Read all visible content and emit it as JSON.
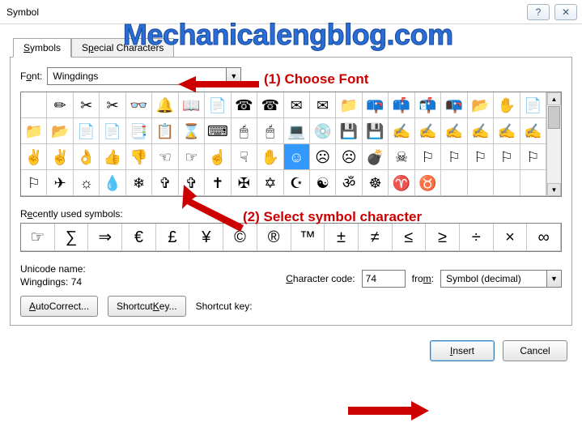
{
  "window": {
    "title": "Symbol",
    "help_btn": "?",
    "close_btn": "✕"
  },
  "watermark": "Mechanicalengblog.com",
  "tabs": {
    "symbols": "Symbols",
    "special": "Special Characters",
    "symbols_ul": "S",
    "special_ul": "P"
  },
  "font": {
    "label_pre": "F",
    "label_ul": "o",
    "label_post": "nt:",
    "value": "Wingdings"
  },
  "annotations": {
    "a1": "(1) Choose Font",
    "a2": "(2) Select symbol character"
  },
  "grid": {
    "rows": [
      [
        "",
        "✏",
        "✂",
        "✂",
        "👓",
        "🔔",
        "📖",
        "📄",
        "☎",
        "☎",
        "✉",
        "✉",
        "📁",
        "📪",
        "📫",
        "📬",
        "📭",
        "📂",
        "✋",
        "📄"
      ],
      [
        "📁",
        "📂",
        "📄",
        "📄",
        "📑",
        "📋",
        "⌛",
        "⌨",
        "🖱",
        "🖱",
        "💻",
        "💿",
        "💾",
        "💾",
        "✍",
        "✍",
        "✍",
        "✍",
        "✍",
        "✍"
      ],
      [
        "✌",
        "✌",
        "👌",
        "👍",
        "👎",
        "☜",
        "☞",
        "☝",
        "☟",
        "✋",
        "☺",
        "☹",
        "☹",
        "💣",
        "☠",
        "⚐",
        "⚐",
        "⚐",
        "⚐",
        "⚐"
      ],
      [
        "⚐",
        "✈",
        "☼",
        "💧",
        "❄",
        "✞",
        "✞",
        "✝",
        "✠",
        "✡",
        "☪",
        "☯",
        "ॐ",
        "☸",
        "♈",
        "♉",
        "",
        "",
        "",
        ""
      ]
    ],
    "selected_row": 2,
    "selected_col": 10
  },
  "recents_label_pre": "R",
  "recents_label_ul": "e",
  "recents_label_post": "cently used symbols:",
  "recents": [
    "☞",
    "∑",
    "⇒",
    "€",
    "£",
    "¥",
    "©",
    "®",
    "™",
    "±",
    "≠",
    "≤",
    "≥",
    "÷",
    "×",
    "∞"
  ],
  "unicode_name_label": "Unicode name:",
  "unicode_name_value": "Wingdings: 74",
  "charcode": {
    "label_ul": "C",
    "label_post": "haracter code:",
    "value": "74"
  },
  "from": {
    "label_pre": "fro",
    "label_ul": "m",
    "label_post": ":",
    "value": "Symbol (decimal)"
  },
  "buttons": {
    "autocorrect_ul": "A",
    "autocorrect_post": "utoCorrect...",
    "shortcut_pre": "Shortcut ",
    "shortcut_ul": "K",
    "shortcut_post": "ey...",
    "shortcut_lbl": "Shortcut key:",
    "insert_ul": "I",
    "insert_post": "nsert",
    "cancel": "Cancel"
  }
}
